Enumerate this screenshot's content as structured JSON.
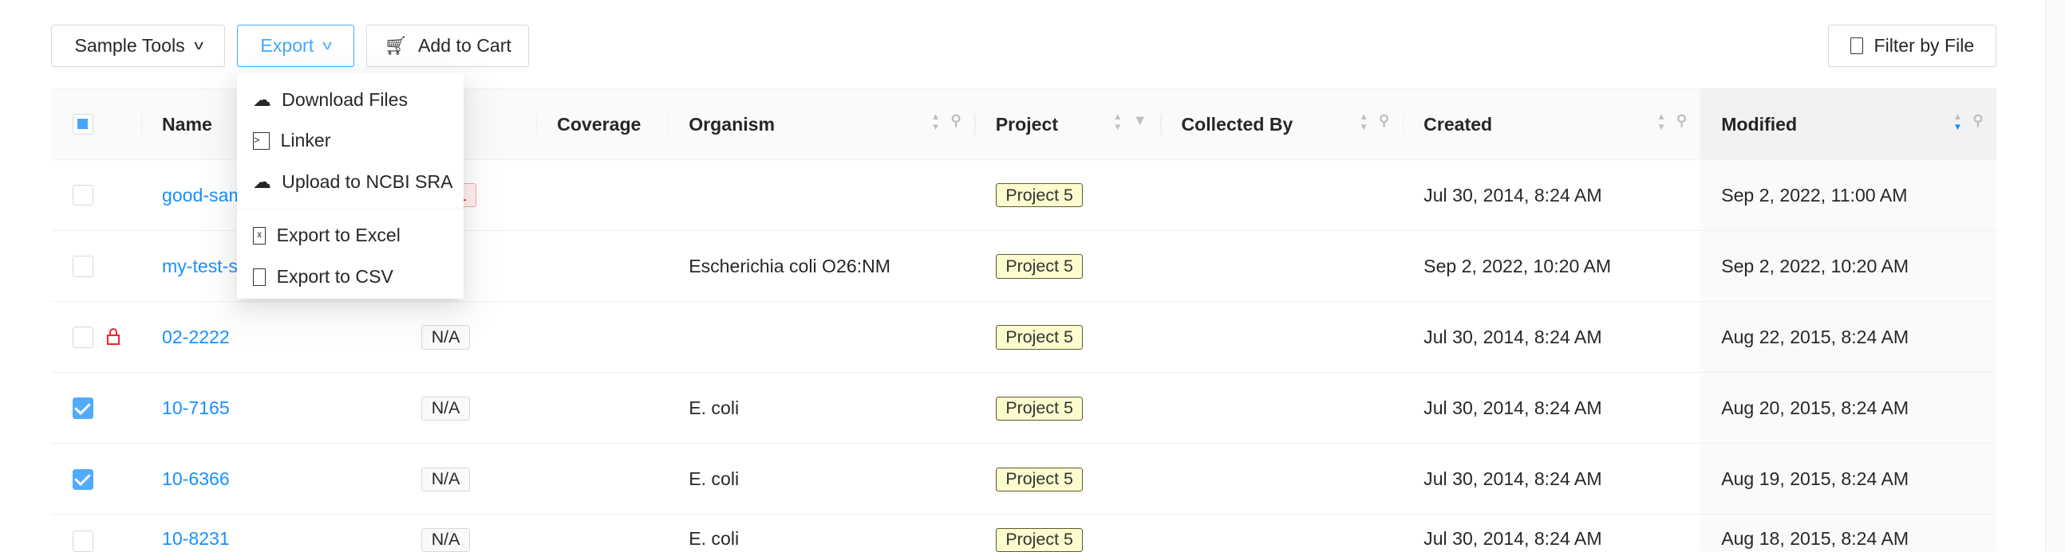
{
  "toolbar": {
    "sample_tools": "Sample Tools",
    "export": "Export",
    "add_to_cart": "Add to Cart",
    "filter_by_file": "Filter by File"
  },
  "export_menu": {
    "items": [
      {
        "label": "Download Files",
        "icon": "cloud-download-icon"
      },
      {
        "label": "Linker",
        "icon": "terminal-icon"
      },
      {
        "label": "Upload to NCBI SRA",
        "icon": "cloud-upload-icon"
      },
      {
        "label": "Export to Excel",
        "icon": "file-excel-icon"
      },
      {
        "label": "Export to CSV",
        "icon": "file-icon"
      }
    ]
  },
  "table": {
    "columns": {
      "name": "Name",
      "coverage": "Coverage",
      "organism": "Organism",
      "project": "Project",
      "collected_by": "Collected By",
      "created": "Created",
      "modified": "Modified"
    },
    "sort": {
      "column": "Modified",
      "direction": "descending"
    },
    "rows": [
      {
        "checked": false,
        "locked": false,
        "name": "good-sample",
        "qc": "FAIL",
        "organism": "",
        "project": "Project 5",
        "collected_by": "",
        "created": "Jul 30, 2014, 8:24 AM",
        "modified": "Sep 2, 2022, 11:00 AM"
      },
      {
        "checked": false,
        "locked": false,
        "name": "my-test-sample",
        "qc": "",
        "organism": "Escherichia coli O26:NM",
        "project": "Project 5",
        "collected_by": "",
        "created": "Sep 2, 2022, 10:20 AM",
        "modified": "Sep 2, 2022, 10:20 AM"
      },
      {
        "checked": false,
        "locked": true,
        "name": "02-2222",
        "qc": "N/A",
        "organism": "",
        "project": "Project 5",
        "collected_by": "",
        "created": "Jul 30, 2014, 8:24 AM",
        "modified": "Aug 22, 2015, 8:24 AM"
      },
      {
        "checked": true,
        "locked": false,
        "name": "10-7165",
        "qc": "N/A",
        "organism": "E. coli",
        "project": "Project 5",
        "collected_by": "",
        "created": "Jul 30, 2014, 8:24 AM",
        "modified": "Aug 20, 2015, 8:24 AM"
      },
      {
        "checked": true,
        "locked": false,
        "name": "10-6366",
        "qc": "N/A",
        "organism": "E. coli",
        "project": "Project 5",
        "collected_by": "",
        "created": "Jul 30, 2014, 8:24 AM",
        "modified": "Aug 19, 2015, 8:24 AM"
      },
      {
        "checked": false,
        "locked": false,
        "name": "10-8231",
        "qc": "N/A",
        "organism": "E. coli",
        "project": "Project 5",
        "collected_by": "",
        "created": "Jul 30, 2014, 8:24 AM",
        "modified": "Aug 18, 2015, 8:24 AM"
      }
    ]
  },
  "colors": {
    "accent": "#1890ff",
    "fail": "#f5222d",
    "project_tag": "#fcfccf"
  }
}
